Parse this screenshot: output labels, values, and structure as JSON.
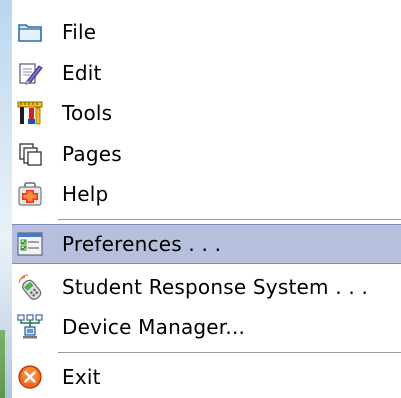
{
  "menu": {
    "items": [
      {
        "label": "File",
        "icon": "folder-icon"
      },
      {
        "label": "Edit",
        "icon": "edit-icon"
      },
      {
        "label": "Tools",
        "icon": "tools-icon"
      },
      {
        "label": "Pages",
        "icon": "pages-icon"
      },
      {
        "label": "Help",
        "icon": "help-icon"
      },
      {
        "label": "Preferences . . .",
        "icon": "preferences-icon",
        "selected": true
      },
      {
        "label": "Student Response System . . .",
        "icon": "student-response-icon"
      },
      {
        "label": "Device Manager...",
        "icon": "device-manager-icon"
      },
      {
        "label": "Exit",
        "icon": "exit-icon"
      }
    ]
  },
  "colors": {
    "selected_background": "#b6bfdc",
    "selected_border": "#7f88b8",
    "separator": "#9a9a9a"
  }
}
